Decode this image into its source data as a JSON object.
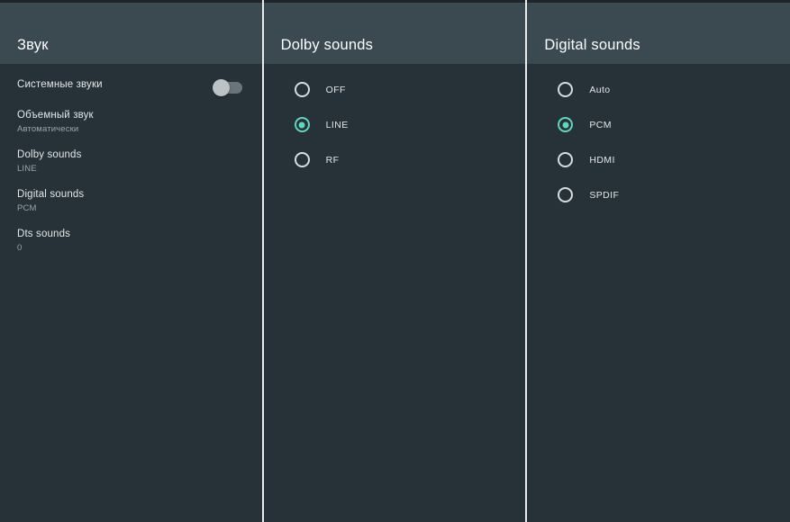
{
  "theme": {
    "header_bg": "#3b4a51",
    "panel_bg": "#263238",
    "divider": "#e9ebec",
    "accent": "#5fd6bd",
    "text_primary": "#e4e7e8",
    "text_secondary": "#9aa5aa"
  },
  "panels": {
    "left": {
      "title": "Звук",
      "items": [
        {
          "label": "Системные звуки",
          "value": "",
          "control": "toggle",
          "toggle_on": false
        },
        {
          "label": "Объемный звук",
          "value": "Автоматически",
          "control": "value"
        },
        {
          "label": "Dolby sounds",
          "value": "LINE",
          "control": "value"
        },
        {
          "label": "Digital sounds",
          "value": "PCM",
          "control": "value"
        },
        {
          "label": "Dts sounds",
          "value": "0",
          "control": "value"
        }
      ]
    },
    "middle": {
      "title": "Dolby sounds",
      "options": [
        {
          "label": "OFF",
          "selected": false
        },
        {
          "label": "LINE",
          "selected": true
        },
        {
          "label": "RF",
          "selected": false
        }
      ]
    },
    "right": {
      "title": "Digital sounds",
      "options": [
        {
          "label": "Auto",
          "selected": false
        },
        {
          "label": "PCM",
          "selected": true
        },
        {
          "label": "HDMI",
          "selected": false
        },
        {
          "label": "SPDIF",
          "selected": false
        }
      ]
    }
  }
}
